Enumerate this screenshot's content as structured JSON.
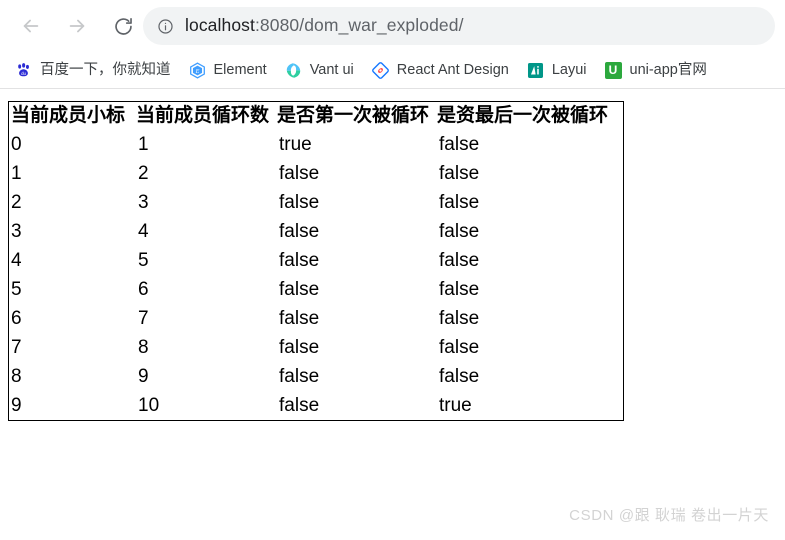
{
  "browser": {
    "nav": {
      "back_label": "Back",
      "back_icon": "arrow-left-icon",
      "forward_label": "Forward",
      "forward_icon": "arrow-right-icon",
      "reload_label": "Reload",
      "reload_icon": "reload-icon"
    },
    "omnibox": {
      "info_icon": "info-circle-icon",
      "host": "localhost",
      "path": ":8080/dom_war_exploded/",
      "full_url": "localhost:8080/dom_war_exploded/"
    },
    "bookmarks": [
      {
        "label": "百度一下，你就知道",
        "icon": "baidu-paw-icon",
        "color": "#2b2bd4"
      },
      {
        "label": "Element",
        "icon": "element-hexagon-icon",
        "color": "#409eff"
      },
      {
        "label": "Vant ui",
        "icon": "vant-icon",
        "color": "#2ecfa0"
      },
      {
        "label": "React Ant Design",
        "icon": "ant-design-diamond-icon",
        "color": "#1677ff"
      },
      {
        "label": "Layui",
        "icon": "layui-square-icon",
        "color": "#009688"
      },
      {
        "label": "uni-app官网",
        "icon": "uniapp-square-icon",
        "color": "#2ca83d"
      }
    ]
  },
  "table": {
    "headers": [
      "当前成员小标",
      "当前成员循环数",
      "是否第一次被循环",
      "是资最后一次被循环"
    ],
    "rows": [
      [
        "0",
        "1",
        "true",
        "false"
      ],
      [
        "1",
        "2",
        "false",
        "false"
      ],
      [
        "2",
        "3",
        "false",
        "false"
      ],
      [
        "3",
        "4",
        "false",
        "false"
      ],
      [
        "4",
        "5",
        "false",
        "false"
      ],
      [
        "5",
        "6",
        "false",
        "false"
      ],
      [
        "6",
        "7",
        "false",
        "false"
      ],
      [
        "7",
        "8",
        "false",
        "false"
      ],
      [
        "8",
        "9",
        "false",
        "false"
      ],
      [
        "9",
        "10",
        "false",
        "true"
      ]
    ]
  },
  "watermark": {
    "text": "CSDN @跟 耿瑞 卷出一片天"
  }
}
